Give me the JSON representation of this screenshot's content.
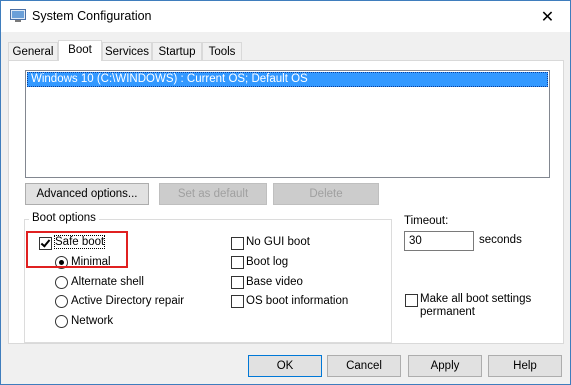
{
  "window": {
    "title": "System Configuration",
    "close_glyph": "✕",
    "icon": "msconfig-icon"
  },
  "tabs": [
    {
      "label": "General",
      "active": false
    },
    {
      "label": "Boot",
      "active": true
    },
    {
      "label": "Services",
      "active": false
    },
    {
      "label": "Startup",
      "active": false
    },
    {
      "label": "Tools",
      "active": false
    }
  ],
  "os_list": {
    "items": [
      "Windows 10 (C:\\WINDOWS) : Current OS; Default OS"
    ],
    "selected_index": 0
  },
  "list_buttons": {
    "advanced": "Advanced options...",
    "set_default": "Set as default",
    "delete": "Delete"
  },
  "boot_options": {
    "title": "Boot options",
    "safe_boot": {
      "label": "Safe boot",
      "checked": true
    },
    "minimal": {
      "label": "Minimal",
      "checked": true
    },
    "alternate_shell": {
      "label": "Alternate shell",
      "checked": false
    },
    "active_directory_repair": {
      "label": "Active Directory repair",
      "checked": false
    },
    "network": {
      "label": "Network",
      "checked": false
    },
    "no_gui_boot": {
      "label": "No GUI boot",
      "checked": false
    },
    "boot_log": {
      "label": "Boot log",
      "checked": false
    },
    "base_video": {
      "label": "Base video",
      "checked": false
    },
    "os_boot_information": {
      "label": "OS boot information",
      "checked": false
    }
  },
  "timeout": {
    "label": "Timeout:",
    "value": "30",
    "unit": "seconds"
  },
  "make_permanent": {
    "label_line1": "Make all boot settings",
    "label_line2": "permanent",
    "checked": false
  },
  "dialog_buttons": {
    "ok": "OK",
    "cancel": "Cancel",
    "apply": "Apply",
    "help": "Help"
  },
  "colors": {
    "selection": "#3399ff",
    "highlight_box": "#e02020",
    "window_border": "#3f7dbd"
  }
}
